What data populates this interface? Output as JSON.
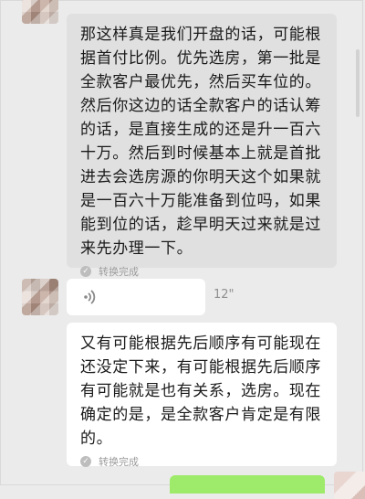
{
  "messages": [
    {
      "text": "那这样真是我们开盘的话，可能根\n据首付比例。优先选房，第一批是\n全款客户最优先，然后买车位的。\n然后你这边的话全款客户的话认筹\n的话，是直接生成的还是升一百六\n十万。然后到时候基本上就是首批\n进去会选房源的你明天这个如果就\n是一百六十万能准备到位吗，如果\n能到位的话，趁早明天过来就是过\n来先办理一下。",
      "status": "转换完成"
    },
    {
      "voice_duration": "12\"",
      "icon": "voice-wave-icon"
    },
    {
      "text": "又有可能根据先后顺序有可能现在\n还没定下来，有可能根据先后顺序\n有可能就是也有关系，选房。现在\n确定的是，是全款客户肯定是有限\n的。",
      "status": "转换完成"
    }
  ],
  "colors": {
    "background": "#ebebeb",
    "gray_bubble": "#e0e0e0",
    "white_bubble": "#ffffff",
    "self_bubble": "#9eea6a"
  }
}
